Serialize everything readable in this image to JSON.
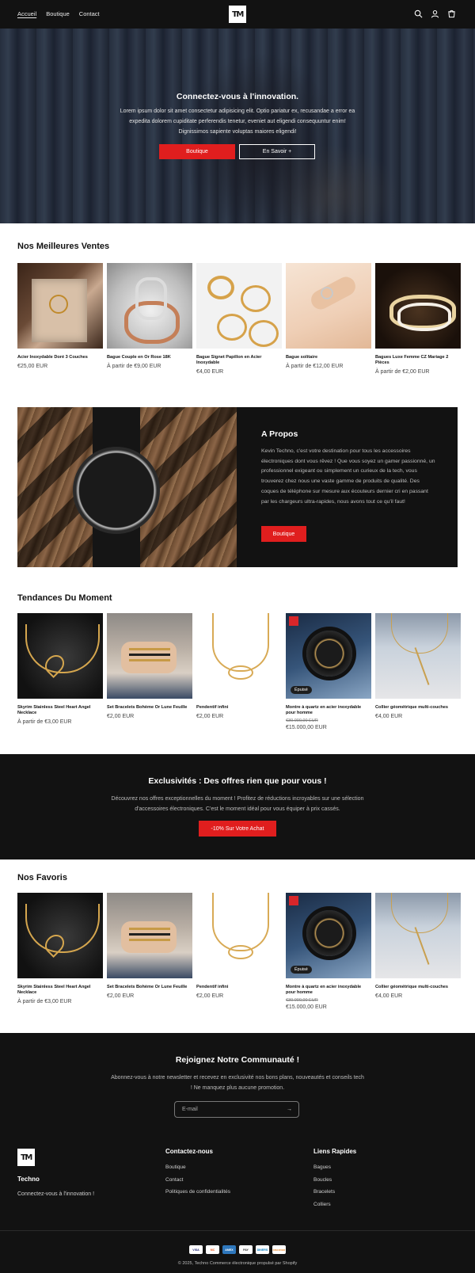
{
  "header": {
    "nav": [
      "Accueil",
      "Boutique",
      "Contact"
    ],
    "logo": "TM",
    "icons": [
      "search-icon",
      "account-icon",
      "cart-icon"
    ]
  },
  "hero": {
    "title": "Connectez-vous à l'innovation.",
    "text": "Lorem ipsum dolor sit amet consectetur adipisicing elit. Optio pariatur ex, recusandae a error ea expedita dolorem cupiditate perferendis tenetur, eveniet aut eligendi consequuntur enim! Dignissimos sapiente voluptas maiores eligendi!",
    "primary_button": "Boutique",
    "secondary_button": "En Savoir +"
  },
  "bestsellers": {
    "title": "Nos Meilleures Ventes",
    "products": [
      {
        "name": "Acier Inoxydable Doré 3 Couches",
        "price": "€25,00 EUR"
      },
      {
        "name": "Bague Couple en Or Rose 18K",
        "price": "À partir de €9,00 EUR"
      },
      {
        "name": "Bague Signet Papillon en Acier Inoxydable",
        "price": "€4,00 EUR"
      },
      {
        "name": "Bague solitaire",
        "price": "À partir de €12,00 EUR"
      },
      {
        "name": "Bagues Luxe Femme CZ Mariage 2 Pièces",
        "price": "À partir de €2,00 EUR"
      }
    ]
  },
  "about": {
    "title": "A Propos",
    "text": "Kevin Techno, c'est votre destination pour tous les accessoires électroniques dont vous rêvez ! Que vous soyez un gamer passionné, un professionnel exigeant ou simplement un curieux de la tech, vous trouverez chez nous une vaste gamme de produits de qualité. Des coques de téléphone sur mesure aux écouteurs dernier cri en passant par les chargeurs ultra-rapides, nous avons tout ce qu'il faut!",
    "button": "Boutique"
  },
  "trending": {
    "title": "Tendances Du Moment",
    "products": [
      {
        "name": "Skyrim Stainless Steel Heart Angel Necklace",
        "price": "À partir de €3,00 EUR"
      },
      {
        "name": "Set Bracelets Bohème Or Lune Feuille",
        "price": "€2,00 EUR"
      },
      {
        "name": "Pendentif infini",
        "price": "€2,00 EUR"
      },
      {
        "name": "Montre à quartz en acier inoxydable pour homme",
        "old_price": "€30.000,00 EUR",
        "price": "€15.000,00 EUR",
        "badge": "Épuisé"
      },
      {
        "name": "Collier géométrique multi-couches",
        "price": "€4,00 EUR"
      }
    ]
  },
  "promo": {
    "title": "Exclusivités : Des offres rien que pour vous !",
    "text": "Découvrez nos offres exceptionnelles du moment ! Profitez de réductions incroyables sur une sélection d'accessoires électroniques. C'est le moment idéal pour vous équiper à prix cassés.",
    "button": "-10% Sur Votre Achat"
  },
  "favorites": {
    "title": "Nos Favoris",
    "products": [
      {
        "name": "Skyrim Stainless Steel Heart Angel Necklace",
        "price": "À partir de €3,00 EUR"
      },
      {
        "name": "Set Bracelets Bohème Or Lune Feuille",
        "price": "€2,00 EUR"
      },
      {
        "name": "Pendentif infini",
        "price": "€2,00 EUR"
      },
      {
        "name": "Montre à quartz en acier inoxydable pour homme",
        "old_price": "€30.000,00 EUR",
        "price": "€15.000,00 EUR",
        "badge": "Épuisé"
      },
      {
        "name": "Collier géométrique multi-couches",
        "price": "€4,00 EUR"
      }
    ]
  },
  "newsletter": {
    "title": "Rejoignez Notre Communauté !",
    "text": "Abonnez-vous à notre newsletter et recevez en exclusivité nos bons plans, nouveautés et conseils tech ! Ne manquez plus aucune promotion.",
    "placeholder": "E-mail"
  },
  "footer": {
    "logo": "TM",
    "brand": "Techno",
    "tagline": "Connectez-vous à l'innovation !",
    "contact_title": "Contactez-nous",
    "contact_links": [
      "Boutique",
      "Contact",
      "Politiques de confidentialités"
    ],
    "quick_title": "Liens Rapides",
    "quick_links": [
      "Bagues",
      "Boucles",
      "Bracelets",
      "Colliers"
    ],
    "payments": [
      "VISA",
      "MC",
      "AMEX",
      "PAY",
      "DINERS",
      "DISCOVER"
    ],
    "copyright": "© 2025, Techno Commerce électronique propulsé par Shopify"
  },
  "colors": {
    "accent": "#e01e1e",
    "dark": "#121212"
  }
}
